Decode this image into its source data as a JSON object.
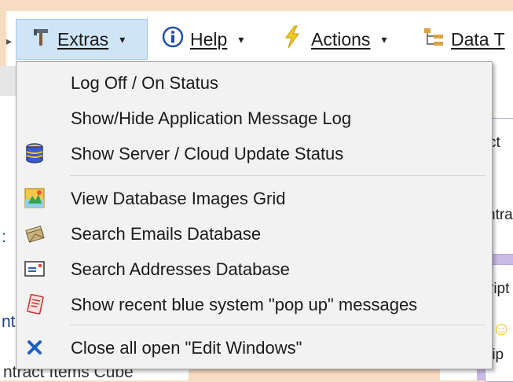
{
  "toolbar": {
    "items": [
      {
        "label": "Extras",
        "icon": "tools-icon"
      },
      {
        "label": "Help",
        "icon": "info-icon"
      },
      {
        "label": "Actions",
        "icon": "lightning-icon"
      },
      {
        "label": "Data T",
        "icon": "tree-icon"
      }
    ]
  },
  "menu": {
    "items": [
      {
        "label": "Log Off / On Status",
        "icon": ""
      },
      {
        "label": "Show/Hide Application Message Log",
        "icon": ""
      },
      {
        "label": "Show Server / Cloud Update Status",
        "icon": "database-stack-icon"
      },
      {
        "label": "View Database Images Grid",
        "icon": "image-grid-icon"
      },
      {
        "label": "Search Emails Database",
        "icon": "emails-icon"
      },
      {
        "label": "Search Addresses Database",
        "icon": "address-card-icon"
      },
      {
        "label": "Show recent blue system \"pop up\" messages",
        "icon": "notes-icon"
      },
      {
        "label": "Close all open \"Edit Windows\"",
        "icon": "close-x-icon"
      }
    ]
  },
  "background": {
    "bottom_text": "ntract Items Cube",
    "right_fragments": [
      "ct",
      "ntra",
      "ript",
      "rip"
    ],
    "left_fragments": [
      ":",
      "nt"
    ]
  },
  "colors": {
    "page_bg": "#f6dcc0",
    "menu_bg": "#f2f2f2",
    "extras_highlight": "#cfe5f7",
    "close_x": "#1f5fbf"
  }
}
